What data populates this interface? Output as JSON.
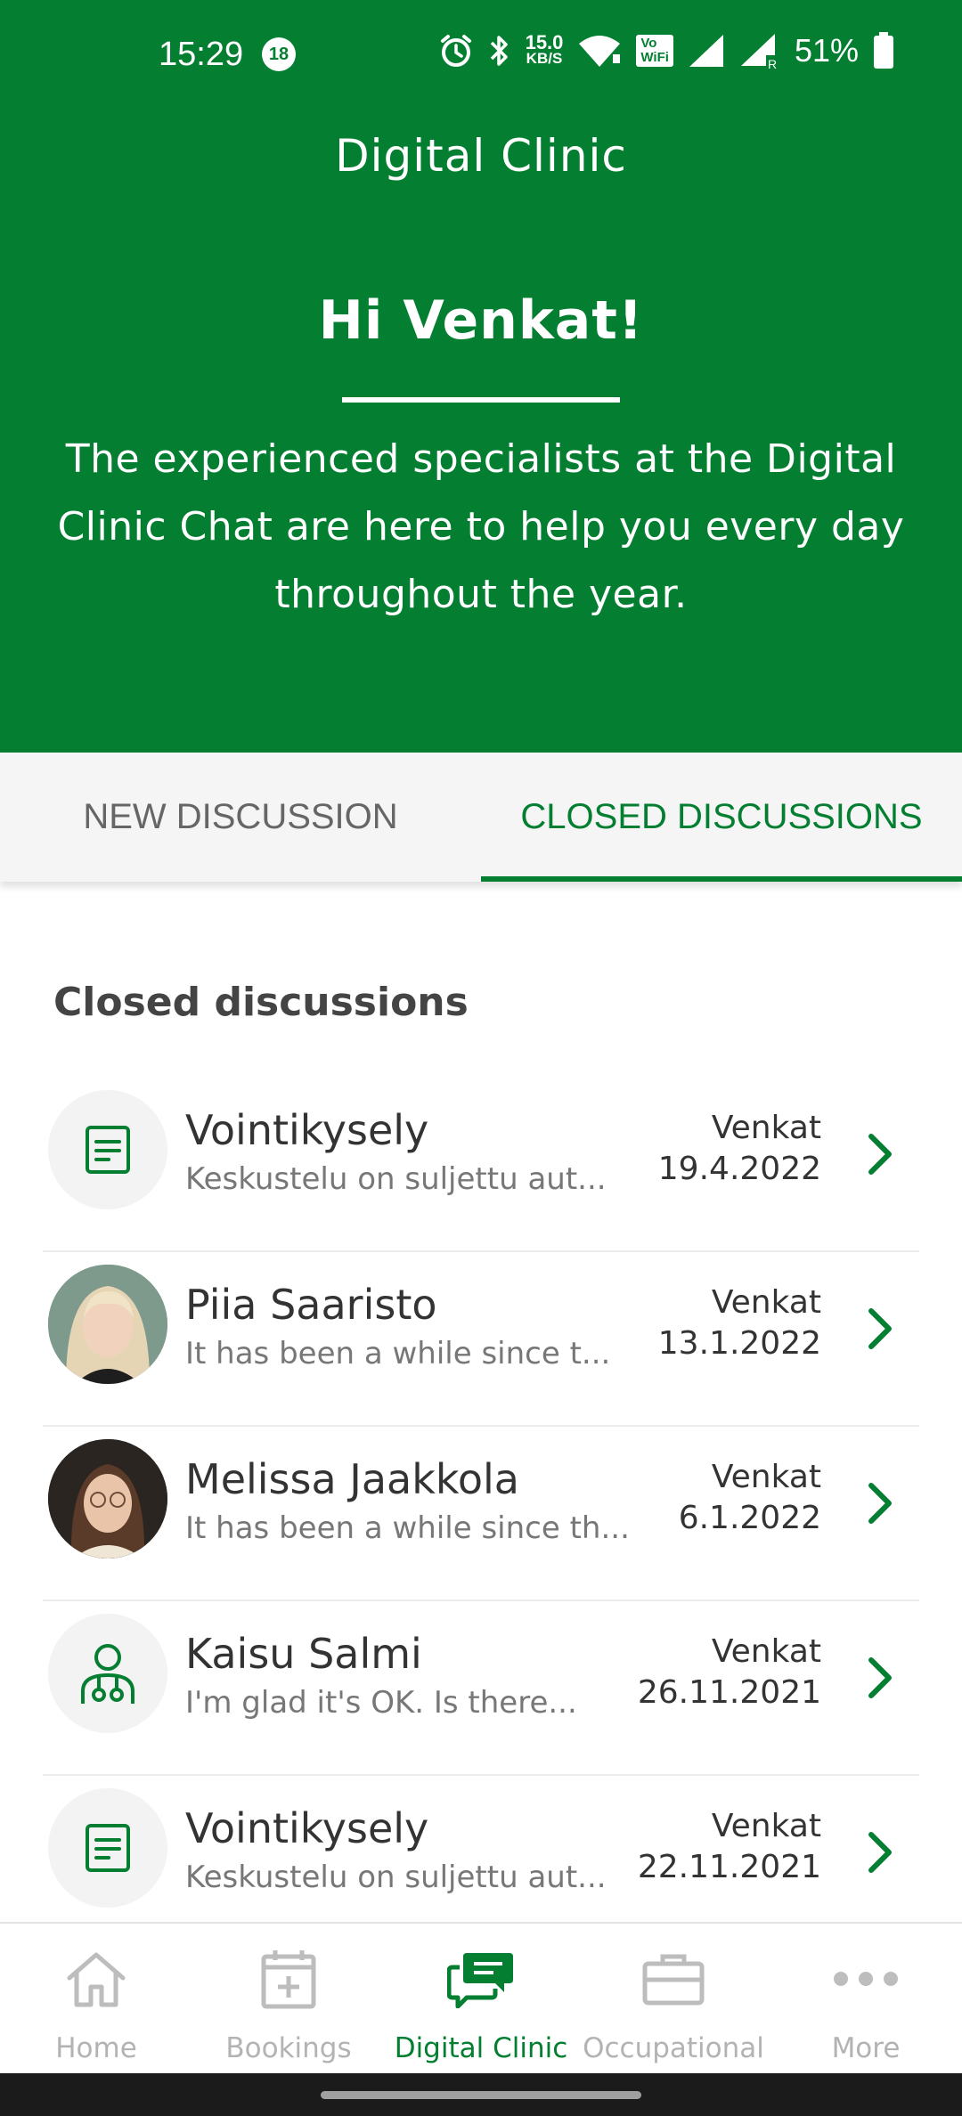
{
  "status_bar": {
    "time": "15:29",
    "notification_badge": "18",
    "net_speed_value": "15.0",
    "net_speed_unit": "KB/S",
    "vowifi_top": "Vo",
    "vowifi_bottom": "WiFi",
    "battery_percent": "51%",
    "icons": [
      "alarm-icon",
      "bluetooth-icon",
      "wifi-icon",
      "vowifi-icon",
      "signal-icon",
      "signal-roaming-icon",
      "battery-icon"
    ]
  },
  "header": {
    "app_title": "Digital Clinic",
    "greeting": "Hi Venkat!",
    "intro": "The experienced specialists at the Digital Clinic Chat are here to help you every day throughout the year."
  },
  "tabs": [
    {
      "label": "NEW DISCUSSION",
      "active": false
    },
    {
      "label": "CLOSED DISCUSSIONS",
      "active": true
    }
  ],
  "section": {
    "title": "Closed discussions"
  },
  "discussions": [
    {
      "name": "Vointikysely",
      "preview": "Keskustelu on suljettu aut...",
      "who": "Venkat",
      "date": "19.4.2022",
      "avatar": "form-icon"
    },
    {
      "name": "Piia Saaristo",
      "preview": "It has been a while since t...",
      "who": "Venkat",
      "date": "13.1.2022",
      "avatar": "photo-blonde"
    },
    {
      "name": "Melissa Jaakkola",
      "preview": "It has been a while since th...",
      "who": "Venkat",
      "date": "6.1.2022",
      "avatar": "photo-dark"
    },
    {
      "name": "Kaisu Salmi",
      "preview": "I'm glad it's OK.  Is there...",
      "who": "Venkat",
      "date": "26.11.2021",
      "avatar": "doctor-icon"
    },
    {
      "name": "Vointikysely",
      "preview": "Keskustelu on suljettu aut...",
      "who": "Venkat",
      "date": "22.11.2021",
      "avatar": "form-icon"
    }
  ],
  "bottom_nav": [
    {
      "label": "Home",
      "icon": "home-icon",
      "active": false
    },
    {
      "label": "Bookings",
      "icon": "calendar-plus-icon",
      "active": false
    },
    {
      "label": "Digital Clinic",
      "icon": "chat-icon",
      "active": true
    },
    {
      "label": "Occupational",
      "icon": "briefcase-icon",
      "active": false
    },
    {
      "label": "More",
      "icon": "more-dots-icon",
      "active": false
    }
  ],
  "colors": {
    "brand_green": "#047f31",
    "inactive_gray": "#b3b3b3",
    "tab_background": "#f5f5f5"
  }
}
